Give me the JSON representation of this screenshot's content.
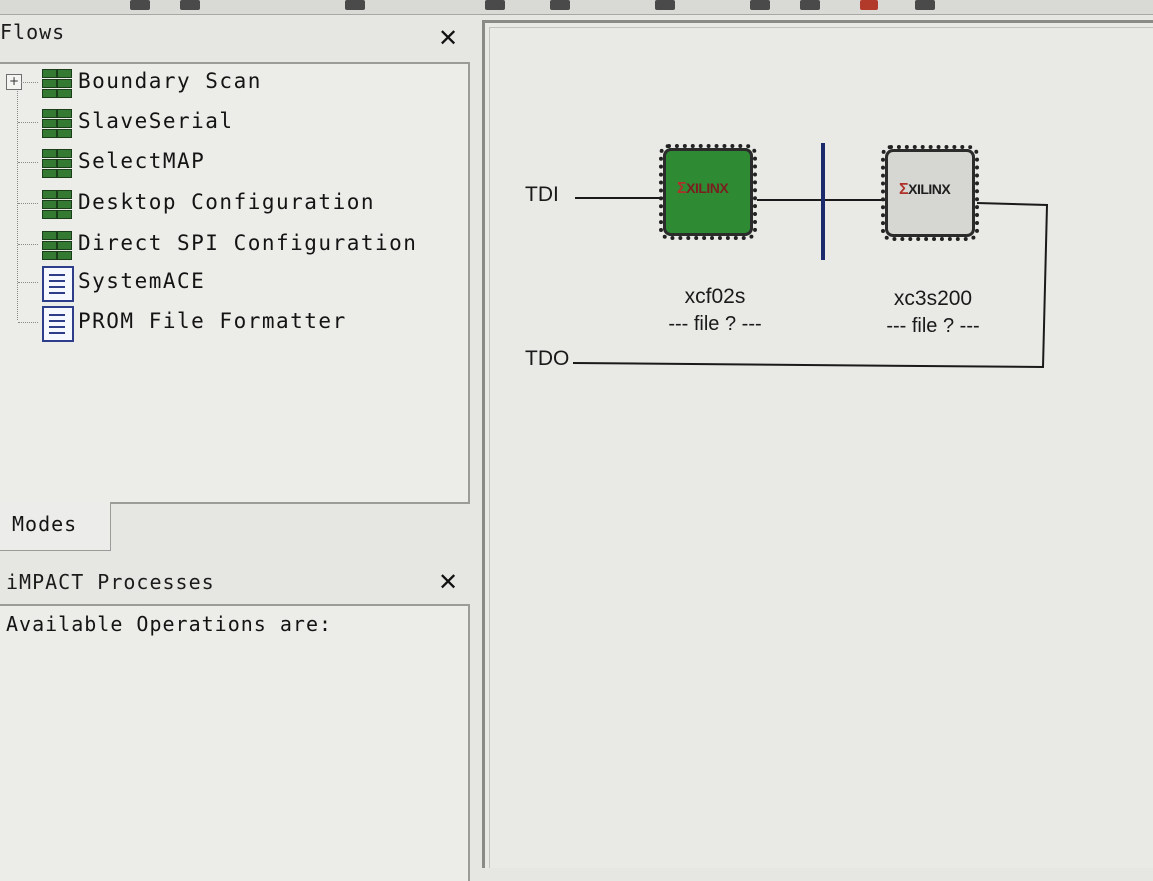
{
  "flows_panel": {
    "title": "Flows",
    "items": [
      {
        "label": "Boundary Scan",
        "icon": "chain-grid-icon",
        "expandable": true
      },
      {
        "label": "SlaveSerial",
        "icon": "chain-grid-icon"
      },
      {
        "label": "SelectMAP",
        "icon": "chain-grid-icon"
      },
      {
        "label": "Desktop Configuration",
        "icon": "chain-grid-icon"
      },
      {
        "label": "Direct SPI Configuration",
        "icon": "chain-grid-icon"
      },
      {
        "label": "SystemACE",
        "icon": "document-icon"
      },
      {
        "label": "PROM File Formatter",
        "icon": "document-icon"
      }
    ]
  },
  "modes_tab": {
    "label": "Modes"
  },
  "processes_panel": {
    "title": "iMPACT Processes",
    "text": "Available Operations are:"
  },
  "chain": {
    "tdi_label": "TDI",
    "tdo_label": "TDO",
    "devices": [
      {
        "name": "xcf02s",
        "file": "--- file ? ---",
        "logo": "XILINX",
        "color": "#2f8a34"
      },
      {
        "name": "xc3s200",
        "file": "--- file ? ---",
        "logo": "XILINX",
        "color": "#d6d6d2"
      }
    ]
  }
}
